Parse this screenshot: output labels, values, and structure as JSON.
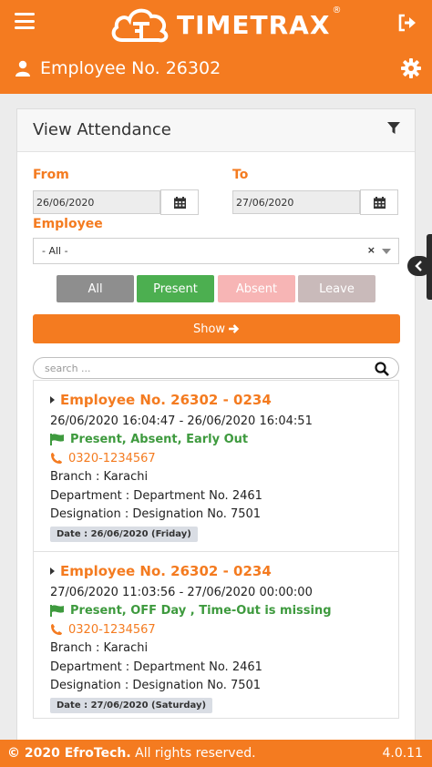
{
  "header": {
    "logo_text": "TIMETRAX",
    "logo_mark": "®",
    "user_title": "Employee No. 26302"
  },
  "panel": {
    "title": "View Attendance",
    "from_label": "From",
    "to_label": "To",
    "from_value": "26/06/2020",
    "to_value": "27/06/2020",
    "employee_label": "Employee",
    "employee_value": "- All -",
    "employee_clear": "×",
    "segments": [
      {
        "label": "All",
        "color": "#8e8e8e"
      },
      {
        "label": "Present",
        "color": "#4caf50"
      },
      {
        "label": "Absent",
        "color": "#f7b5b5"
      },
      {
        "label": "Leave",
        "color": "#c9baba"
      }
    ],
    "show_label": "Show",
    "search_placeholder": "search ..."
  },
  "records": [
    {
      "title": "Employee No. 26302 - 0234",
      "time_range": "26/06/2020 16:04:47 - 26/06/2020 16:04:51",
      "status": "Present, Absent, Early Out",
      "phone": "0320-1234567",
      "branch": "Branch : Karachi",
      "department": "Department : Department No. 2461",
      "designation": "Designation : Designation No. 7501",
      "date": "Date : 26/06/2020 (Friday)"
    },
    {
      "title": "Employee No. 26302 - 0234",
      "time_range": "27/06/2020 11:03:56 - 27/06/2020 00:00:00",
      "status": "Present, OFF Day , Time-Out is missing",
      "phone": "0320-1234567",
      "branch": "Branch : Karachi",
      "department": "Department : Department No. 2461",
      "designation": "Designation : Designation No. 7501",
      "date": "Date : 27/06/2020 (Saturday)"
    }
  ],
  "footer": {
    "copyright": "© 2020 EfroTech.",
    "rights": " All rights reserved.",
    "version": "4.0.11"
  },
  "colors": {
    "brand": "#f47b20",
    "status_green": "#3e9a3e"
  },
  "icons": [
    "menu-icon",
    "cloud-logo-icon",
    "logout-icon",
    "user-icon",
    "gear-icon",
    "filter-icon",
    "calendar-icon",
    "arrow-right-icon",
    "search-icon",
    "flag-icon",
    "phone-icon",
    "chevron-left-icon"
  ]
}
